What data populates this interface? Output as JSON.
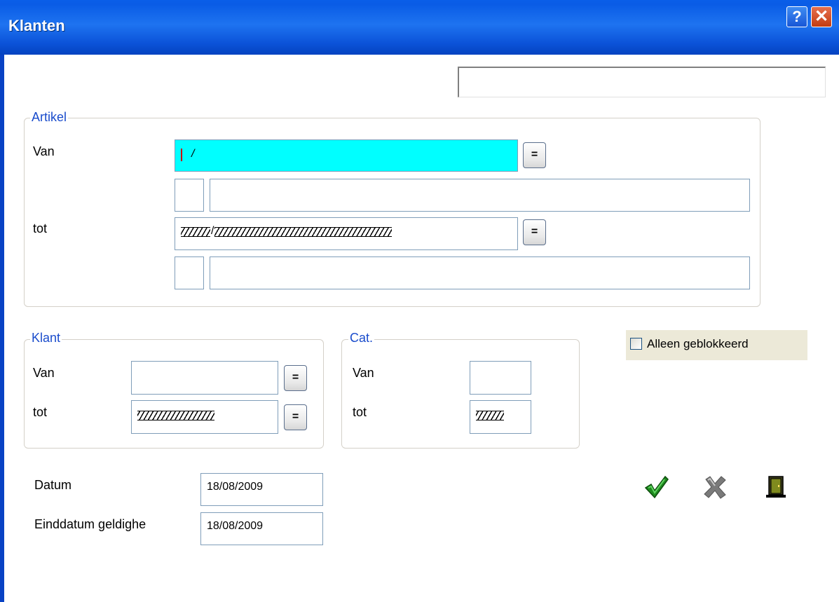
{
  "window": {
    "title": "Klanten",
    "help_label": "?",
    "close_label": "✕"
  },
  "top_field": {
    "value": ""
  },
  "artikel": {
    "legend": "Artikel",
    "van_label": "Van",
    "tot_label": "tot",
    "van_value_sep": "/",
    "tot_value_sep": "/",
    "lookup_label": "="
  },
  "klant": {
    "legend": "Klant",
    "van_label": "Van",
    "tot_label": "tot",
    "lookup_label": "="
  },
  "cat": {
    "legend": "Cat.",
    "van_label": "Van",
    "tot_label": "tot"
  },
  "alleen_geblokkeerd": {
    "label": "Alleen geblokkeerd",
    "checked": false
  },
  "datum": {
    "label": "Datum",
    "value": "18/08/2009"
  },
  "einddatum": {
    "label": "Einddatum geldighe",
    "value": "18/08/2009"
  },
  "actions": {
    "ok_icon": "checkmark-icon",
    "cancel_icon": "x-icon",
    "exit_icon": "door-icon"
  }
}
